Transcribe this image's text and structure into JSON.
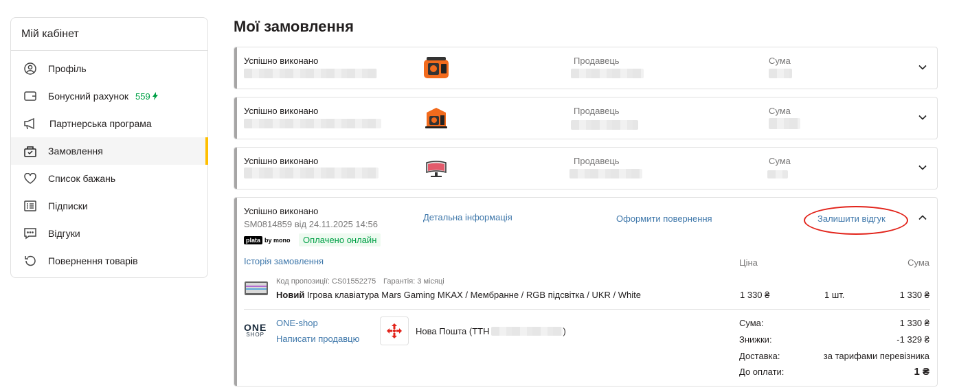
{
  "sidebar": {
    "title": "Мій кабінет",
    "items": [
      {
        "label": "Профіль",
        "icon": "user-icon"
      },
      {
        "label": "Бонусний рахунок",
        "icon": "wallet-icon",
        "badge": "559"
      },
      {
        "label": "Партнерська програма",
        "icon": "megaphone-icon"
      },
      {
        "label": "Замовлення",
        "icon": "orders-icon",
        "active": true
      },
      {
        "label": "Список бажань",
        "icon": "heart-icon"
      },
      {
        "label": "Підписки",
        "icon": "list-icon"
      },
      {
        "label": "Відгуки",
        "icon": "comment-icon"
      },
      {
        "label": "Повернення товарів",
        "icon": "return-icon"
      }
    ]
  },
  "main": {
    "title": "Мої замовлення",
    "collapsed_orders": [
      {
        "status": "Успішно виконано",
        "seller_label": "Продавець",
        "sum_label": "Сума",
        "thumb": "generator-icon"
      },
      {
        "status": "Успішно виконано",
        "seller_label": "Продавець",
        "sum_label": "Сума",
        "thumb": "generator-icon"
      },
      {
        "status": "Успішно виконано",
        "seller_label": "Продавець",
        "sum_label": "Сума",
        "thumb": "monitor-icon"
      }
    ],
    "expanded_order": {
      "status": "Успішно виконано",
      "number": "SM0814859 від 24.11.2025 14:56",
      "payment_brand": "plata",
      "payment_by": "by mono",
      "paid_label": "Оплачено онлайн",
      "details_link": "Детальна інформація",
      "return_link": "Оформити повернення",
      "review_link": "Залишити відгук",
      "history_link": "Історія замовлення",
      "col_price": "Ціна",
      "col_sum": "Сума",
      "item": {
        "offer_code": "Код пропозиції: CS01552275",
        "warranty": "Гарантія: 3 місяці",
        "condition": "Новий",
        "name": "Ігрова клавіатура Mars Gaming MKAX / Мембранне / RGB підсвітка / UKR / White",
        "price": "1 330 ₴",
        "qty": "1 шт.",
        "sum": "1 330 ₴"
      },
      "seller": {
        "logo_top": "ONE",
        "logo_bottom": "SHOP",
        "name": "ONE-shop",
        "write_link": "Написати продавцю"
      },
      "delivery": {
        "label": "Нова Пошта (ТТН",
        "closing": ")"
      },
      "totals": [
        {
          "label": "Сума:",
          "value": "1 330 ₴"
        },
        {
          "label": "Знижки:",
          "value": "-1 329 ₴"
        },
        {
          "label": "Доставка:",
          "value": "за тарифами перевізника"
        },
        {
          "label": "До оплати:",
          "value": "1 ₴"
        }
      ]
    }
  },
  "colors": {
    "accent": "#ffbf00",
    "link": "#3e77aa",
    "green": "#00a046",
    "highlight": "#e2231a"
  }
}
